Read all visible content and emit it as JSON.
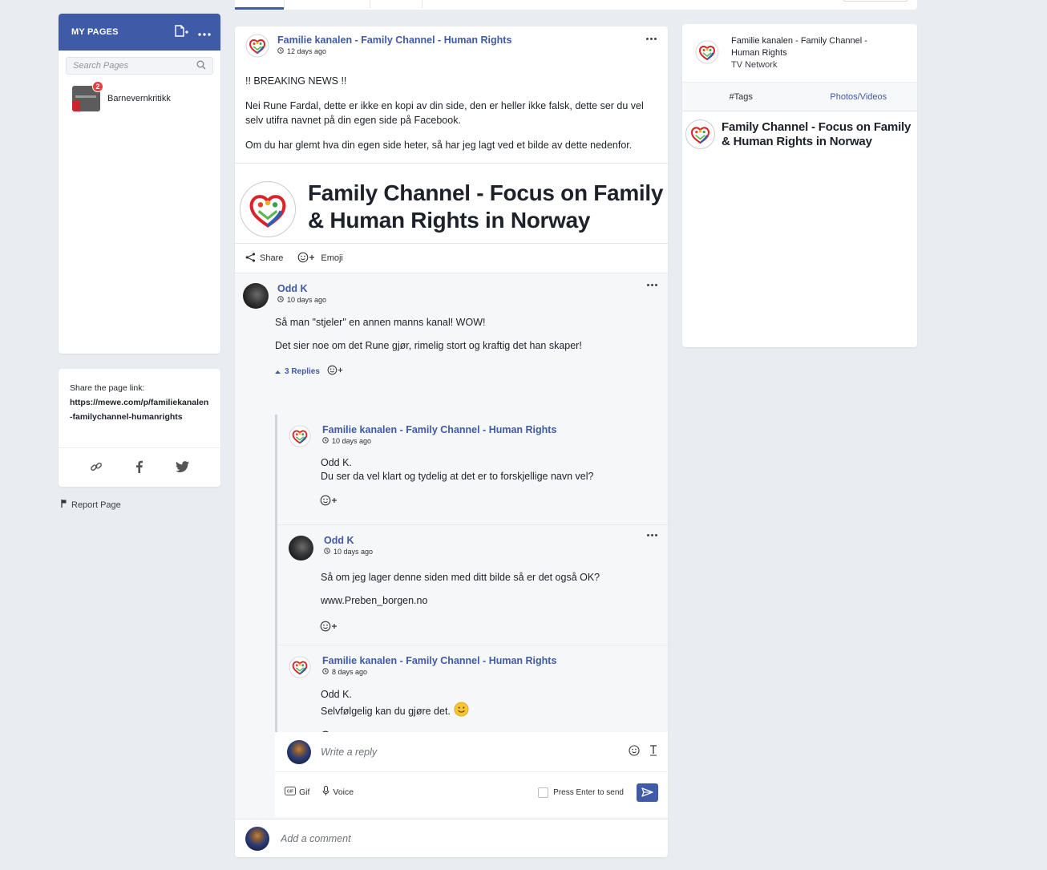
{
  "sidebar": {
    "title": "MY PAGES",
    "search_placeholder": "Search Pages",
    "pages": [
      {
        "name": "Barnevernkritikk",
        "badge": "2"
      }
    ],
    "share": {
      "label": "Share the page link:",
      "link": "https://mewe.com/p/familiekanalen-familychannel-humanrights"
    },
    "report": "Report Page"
  },
  "post": {
    "author": "Familie kanalen - Family Channel - Human Rights",
    "time": "12 days ago",
    "paragraphs": [
      "!! BREAKING NEWS !!",
      "Nei Rune Fardal, dette er ikke en kopi av din side, den er heller ikke falsk, dette ser du vel selv utifra navnet på din egen side på Facebook.",
      "Om du har glemt hva din egen side heter, så har jeg lagt ved et bilde av dette nedenfor."
    ],
    "banner_line1": "Family Channel - Focus on Family",
    "banner_line2": "& Human Rights in Norway",
    "actions": {
      "share": "Share",
      "emoji": "Emoji"
    }
  },
  "comment": {
    "author": "Odd K",
    "time": "10 days ago",
    "lines": [
      "Så man \"stjeler\" en annen manns kanal! WOW!",
      "Det sier noe om det Rune gjør, rimelig stort og kraftig det han skaper!"
    ],
    "replies_label": "3 Replies"
  },
  "replies": [
    {
      "author": "Familie kanalen - Family Channel - Human Rights",
      "time": "10 days ago",
      "line1": "Odd K.",
      "line2": "Du ser da vel klart og tydelig at det er to forskjellige navn vel?"
    },
    {
      "author": "Odd K",
      "time": "10 days ago",
      "line1": "Så om jeg lager denne siden med ditt bilde så er det også OK?",
      "line2": "www.Preben_borgen.no"
    },
    {
      "author": "Familie kanalen - Family Channel - Human Rights",
      "time": "8 days ago",
      "line1": "Odd K.",
      "line2": "Selvfølgelig kan du gjøre det."
    }
  ],
  "write_reply": {
    "placeholder": "Write a reply",
    "gif": "Gif",
    "voice": "Voice",
    "enter_to_send": "Press Enter to send"
  },
  "add_comment": {
    "placeholder": "Add a comment"
  },
  "info": {
    "name_line1": "Familie kanalen - Family Channel -",
    "name_line2": "Human Rights",
    "category": "TV Network",
    "tabs": [
      "#Tags",
      "Photos/Videos"
    ],
    "banner_line1": "Family Channel - Focus on Family",
    "banner_line2": "& Human Rights in Norway"
  },
  "colors": {
    "brand": "#3f5aa6",
    "badge": "#e0403f",
    "background": "#e9ecf1"
  }
}
